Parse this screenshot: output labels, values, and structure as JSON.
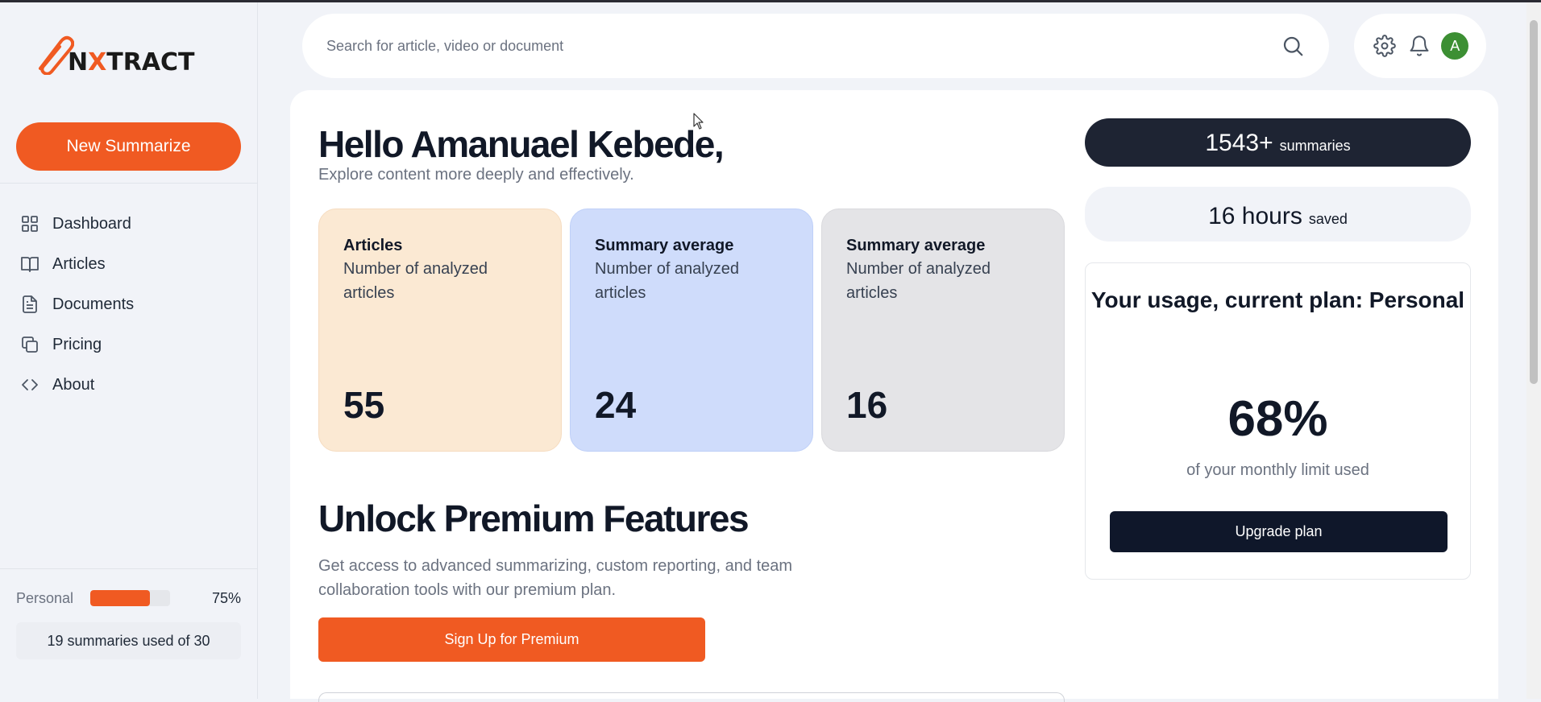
{
  "brand": {
    "logo_prefix": "N",
    "logo_accent": "X",
    "logo_suffix": "TRACT",
    "accent_color": "#f05a22"
  },
  "sidebar": {
    "new_button": "New Summarize",
    "items": [
      {
        "label": "Dashboard",
        "icon": "grid-icon"
      },
      {
        "label": "Articles",
        "icon": "book-open-icon"
      },
      {
        "label": "Documents",
        "icon": "document-icon"
      },
      {
        "label": "Pricing",
        "icon": "copy-icon"
      },
      {
        "label": "About",
        "icon": "code-icon"
      }
    ],
    "plan": {
      "name": "Personal",
      "percent_label": "75%",
      "percent": 75
    },
    "usage_text": "19 summaries used of 30"
  },
  "search": {
    "placeholder": "Search for article, video or document"
  },
  "user": {
    "avatar_initial": "A",
    "avatar_color": "#3c8f33"
  },
  "main": {
    "greeting": "Hello Amanuael Kebede,",
    "subtitle": "Explore content more deeply and effectively.",
    "cards": [
      {
        "title": "Articles",
        "description": "Number of analyzed articles",
        "value": "55",
        "color": "#fbe9d3"
      },
      {
        "title": "Summary average",
        "description": "Number of analyzed articles",
        "value": "24",
        "color": "#cfdcfb"
      },
      {
        "title": "Summary average",
        "description": "Number of analyzed articles",
        "value": "16",
        "color": "#e4e4e7"
      }
    ],
    "premium": {
      "title": "Unlock Premium Features",
      "description": "Get access to advanced summarizing, custom reporting, and team collaboration tools with our premium plan.",
      "button": "Sign Up for Premium"
    }
  },
  "stats": {
    "summaries_count": "1543+",
    "summaries_label": "summaries",
    "hours_count": "16 hours",
    "hours_label": "saved"
  },
  "plan_card": {
    "title": "Your usage, current plan: Personal",
    "percent": "68%",
    "description": "of your monthly limit used",
    "button": "Upgrade plan"
  }
}
